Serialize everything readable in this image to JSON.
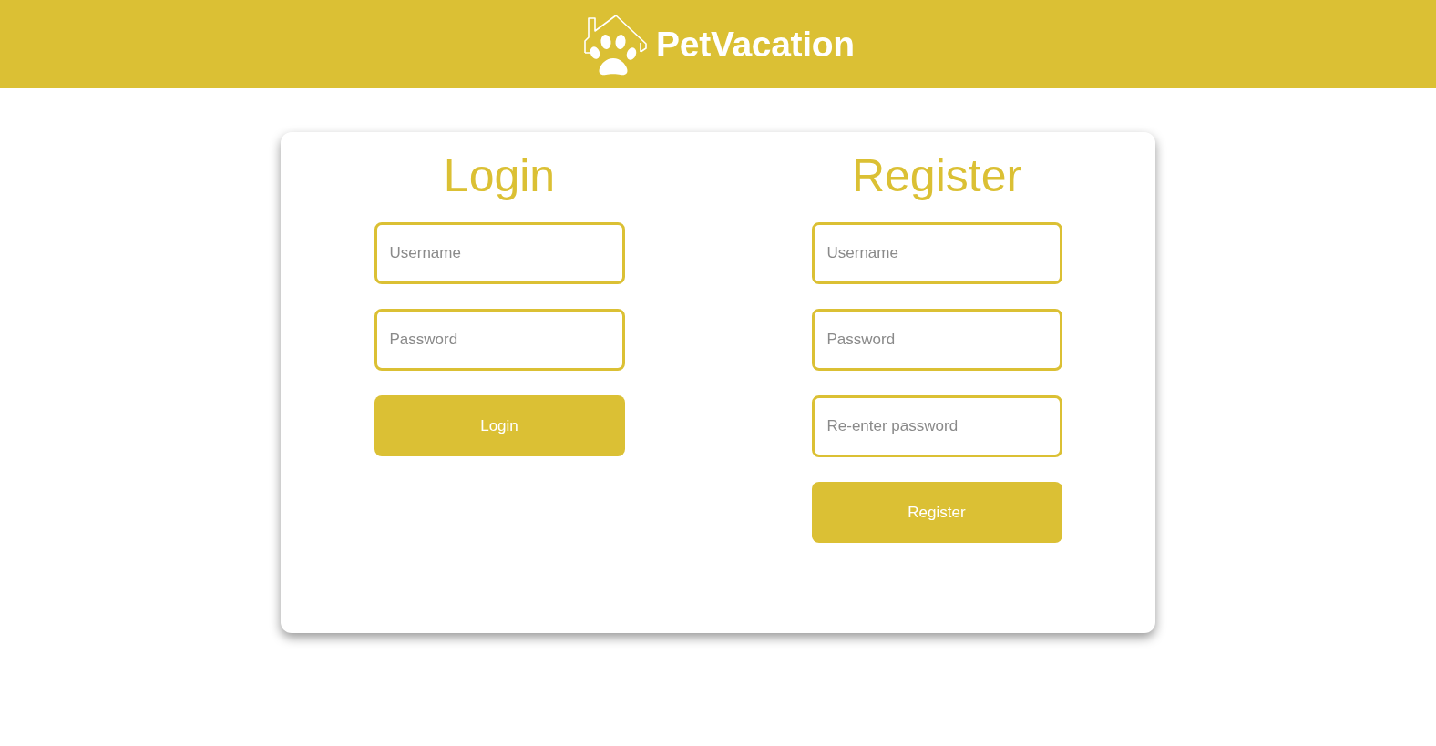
{
  "header": {
    "logo_text": "PetVacation"
  },
  "login": {
    "title": "Login",
    "fields": [
      {
        "placeholder": "Username"
      },
      {
        "placeholder": "Password"
      }
    ],
    "button": "Login"
  },
  "register": {
    "title": "Register",
    "fields": [
      {
        "placeholder": "Username"
      },
      {
        "placeholder": "Password"
      },
      {
        "placeholder": "Re-enter password"
      }
    ],
    "button": "Register"
  }
}
